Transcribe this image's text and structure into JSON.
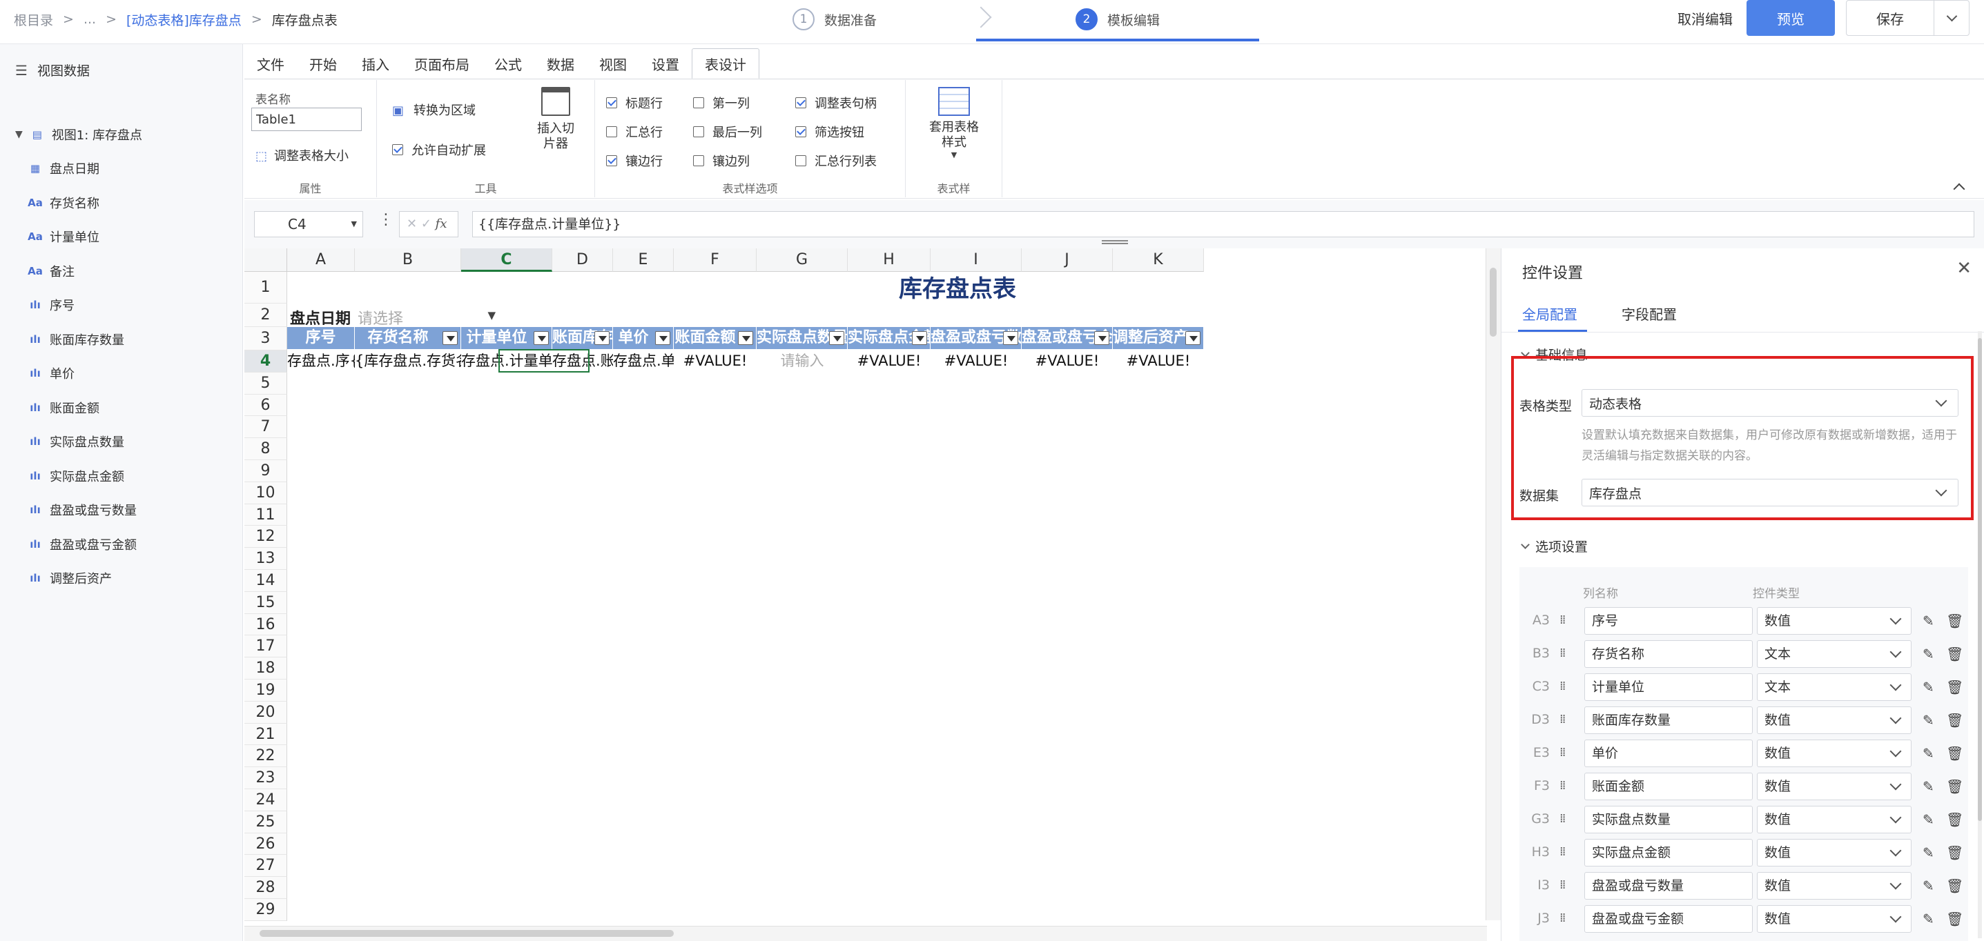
{
  "breadcrumb": {
    "root": "根目录",
    "sep": ">",
    "ellipsis": "...",
    "parent": "[动态表格]库存盘点",
    "current": "库存盘点表"
  },
  "steps": [
    {
      "num": "1",
      "label": "数据准备"
    },
    {
      "num": "2",
      "label": "模板编辑"
    }
  ],
  "header_actions": {
    "cancel": "取消编辑",
    "preview": "预览",
    "save": "保存"
  },
  "colors": {
    "accent": "#3c6ee0",
    "header_fill": "#7ea2d6",
    "title": "#1f3a7a",
    "highlight_border": "#e02020"
  },
  "sidebar": {
    "title": "视图数据",
    "root": "视图1: 库存盘点",
    "fields": [
      {
        "icon": "date-icon",
        "glyph": "▦",
        "label": "盘点日期"
      },
      {
        "icon": "text-icon",
        "glyph": "Aa",
        "label": "存货名称"
      },
      {
        "icon": "text-icon",
        "glyph": "Aa",
        "label": "计量单位"
      },
      {
        "icon": "text-icon",
        "glyph": "Aa",
        "label": "备注"
      },
      {
        "icon": "number-icon",
        "glyph": "ılı",
        "label": "序号"
      },
      {
        "icon": "number-icon",
        "glyph": "ılı",
        "label": "账面库存数量"
      },
      {
        "icon": "number-icon",
        "glyph": "ılı",
        "label": "单价"
      },
      {
        "icon": "number-icon",
        "glyph": "ılı",
        "label": "账面金额"
      },
      {
        "icon": "number-icon",
        "glyph": "ılı",
        "label": "实际盘点数量"
      },
      {
        "icon": "number-icon",
        "glyph": "ılı",
        "label": "实际盘点金额"
      },
      {
        "icon": "number-icon",
        "glyph": "ılı",
        "label": "盘盈或盘亏数量"
      },
      {
        "icon": "number-icon",
        "glyph": "ılı",
        "label": "盘盈或盘亏金额"
      },
      {
        "icon": "number-icon",
        "glyph": "ılı",
        "label": "调整后资产"
      }
    ]
  },
  "ribbon": {
    "tabs": [
      "文件",
      "开始",
      "插入",
      "页面布局",
      "公式",
      "数据",
      "视图",
      "设置",
      "表设计"
    ],
    "props": {
      "table_name_label": "表名称",
      "table_name_value": "Table1",
      "resize": "调整表格大小",
      "group": "属性"
    },
    "tools": {
      "convert": "转换为区域",
      "auto_expand": "允许自动扩展",
      "slicer": "插入切片器",
      "group": "工具"
    },
    "style_options": {
      "items": [
        {
          "label": "标题行",
          "checked": true
        },
        {
          "label": "汇总行",
          "checked": false
        },
        {
          "label": "镶边行",
          "checked": true
        },
        {
          "label": "第一列",
          "checked": false
        },
        {
          "label": "最后一列",
          "checked": false
        },
        {
          "label": "镶边列",
          "checked": false
        },
        {
          "label": "调整表句柄",
          "checked": true
        },
        {
          "label": "筛选按钮",
          "checked": true
        },
        {
          "label": "汇总行列表",
          "checked": false
        }
      ],
      "group": "表式样选项"
    },
    "table_style": {
      "label": "套用表格样式",
      "group": "表式样"
    }
  },
  "formula": {
    "cell": "C4",
    "fx": "fx",
    "value": "{{库存盘点.计量单位}}"
  },
  "sheet": {
    "columns": [
      "A",
      "B",
      "C",
      "D",
      "E",
      "F",
      "G",
      "H",
      "I",
      "J",
      "K"
    ],
    "rows": [
      "1",
      "2",
      "3",
      "4",
      "5",
      "6",
      "7",
      "8",
      "9",
      "10",
      "11",
      "12",
      "13",
      "14",
      "15",
      "16",
      "17",
      "18",
      "19",
      "20",
      "21",
      "22",
      "23",
      "24",
      "25",
      "26",
      "27",
      "28",
      "29"
    ],
    "title": "库存盘点表",
    "date_label": "盘点日期",
    "date_placeholder": "请选择",
    "headers": [
      "序号",
      "存货名称",
      "计量单位",
      "账面库存数量",
      "单价",
      "账面金额",
      "实际盘点数量",
      "实际盘点金额",
      "盘盈或盘亏数量",
      "盘盈或盘亏金额",
      "调整后资产"
    ],
    "row4": [
      "存盘点.序{",
      "{库存盘点.存货名称}",
      "存盘点.计量单",
      "存盘点.账面库存数",
      "存盘点.单",
      "#VALUE!",
      "请输入",
      "#VALUE!",
      "#VALUE!",
      "#VALUE!",
      "#VALUE!"
    ],
    "selected_cell": "C4"
  },
  "panel": {
    "title": "控件设置",
    "tabs": [
      "全局配置",
      "字段配置"
    ],
    "basic": "基础信息",
    "table_type_label": "表格类型",
    "table_type_value": "动态表格",
    "table_type_help": "设置默认填充数据来自数据集，用户可修改原有数据或新增数据，适用于灵活编辑与指定数据关联的内容。",
    "dataset_label": "数据集",
    "dataset_value": "库存盘点",
    "options": "选项设置",
    "col_name_header": "列名称",
    "col_type_header": "控件类型",
    "list": [
      {
        "key": "A3",
        "name": "序号",
        "type": "数值"
      },
      {
        "key": "B3",
        "name": "存货名称",
        "type": "文本"
      },
      {
        "key": "C3",
        "name": "计量单位",
        "type": "文本"
      },
      {
        "key": "D3",
        "name": "账面库存数量",
        "type": "数值"
      },
      {
        "key": "E3",
        "name": "单价",
        "type": "数值"
      },
      {
        "key": "F3",
        "name": "账面金额",
        "type": "数值"
      },
      {
        "key": "G3",
        "name": "实际盘点数量",
        "type": "数值"
      },
      {
        "key": "H3",
        "name": "实际盘点金额",
        "type": "数值"
      },
      {
        "key": "I3",
        "name": "盘盈或盘亏数量",
        "type": "数值"
      },
      {
        "key": "J3",
        "name": "盘盈或盘亏金额",
        "type": "数值"
      }
    ]
  }
}
